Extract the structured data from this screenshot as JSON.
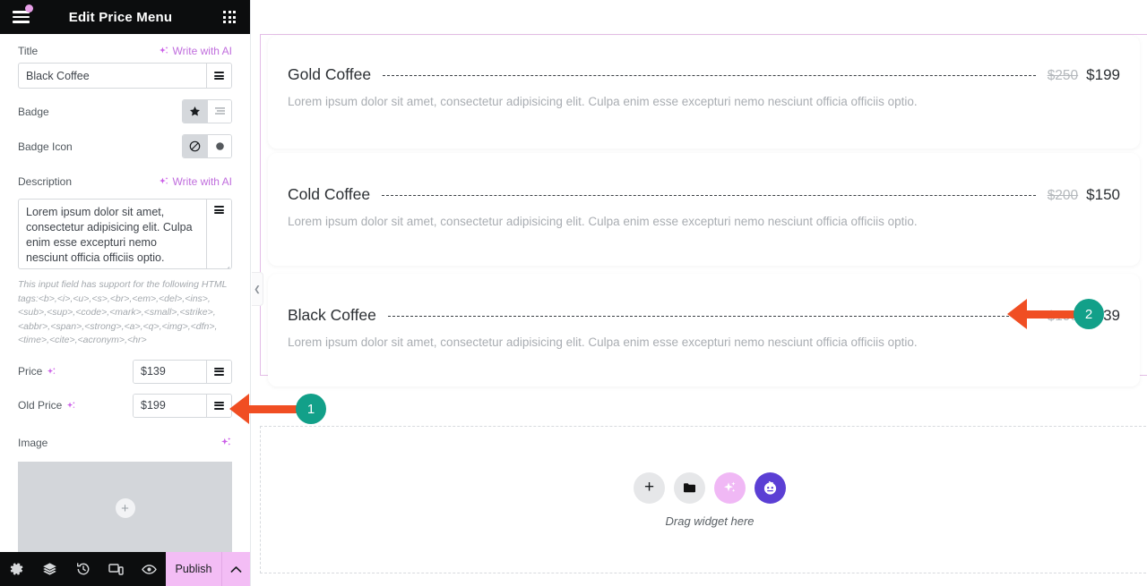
{
  "panel": {
    "title": "Edit Price Menu",
    "hamburger_icon": "hamburger-menu-icon",
    "grid_icon": "apps-grid-icon",
    "fields": {
      "title": {
        "label": "Title",
        "ai_label": "Write with AI",
        "value": "Black Coffee",
        "placeholder": ""
      },
      "badge": {
        "label": "Badge",
        "options": [
          "star",
          "list"
        ],
        "selected": "star"
      },
      "badge_icon": {
        "label": "Badge Icon",
        "options": [
          "none",
          "circle"
        ],
        "selected": "none"
      },
      "description": {
        "label": "Description",
        "ai_label": "Write with AI",
        "value": "Lorem ipsum dolor sit amet, consectetur adipisicing elit. Culpa enim esse excepturi nemo nesciunt officia officiis optio.",
        "help": "This input field has support for the following HTML tags:<b>,<i>,<u>,<s>,<br>,<em>,<del>,<ins>,<sub>,<sup>,<code>,<mark>,<small>,<strike>,<abbr>,<span>,<strong>,<a>,<q>,<img>,<dfn>,<time>,<cite>,<acronym>,<hr>"
      },
      "price": {
        "label": "Price",
        "value": "$139"
      },
      "old_price": {
        "label": "Old Price",
        "value": "$199"
      },
      "image": {
        "label": "Image",
        "add_icon": "plus-icon"
      }
    },
    "footer": {
      "icons": [
        "gear-icon",
        "layers-icon",
        "history-icon",
        "responsive-icon",
        "preview-eye-icon"
      ],
      "publish_label": "Publish",
      "caret_icon": "chevron-up-icon"
    }
  },
  "canvas": {
    "accent_border": "#e3bde6",
    "items": [
      {
        "title": "Gold Coffee",
        "old_price": "$250",
        "price": "$199",
        "description": "Lorem ipsum dolor sit amet, consectetur adipisicing elit. Culpa enim esse excepturi nemo nesciunt officia officiis optio."
      },
      {
        "title": "Cold Coffee",
        "old_price": "$200",
        "price": "$150",
        "description": "Lorem ipsum dolor sit amet, consectetur adipisicing elit. Culpa enim esse excepturi nemo nesciunt officia officiis optio."
      },
      {
        "title": "Black Coffee",
        "old_price": "$199",
        "price": "$139",
        "description": "Lorem ipsum dolor sit amet, consectetur adipisicing elit. Culpa enim esse excepturi nemo nesciunt officia officiis optio."
      }
    ],
    "drop_zone": {
      "label": "Drag widget here",
      "icons": [
        "plus-icon",
        "folder-icon",
        "ai-sparkle-icon",
        "ai-bot-icon"
      ]
    },
    "collapse_handle_icon": "chevron-left-icon"
  },
  "annotations": [
    {
      "number": "1",
      "color": "#12a089",
      "arrow_color": "#f04e23"
    },
    {
      "number": "2",
      "color": "#12a089",
      "arrow_color": "#f04e23"
    }
  ]
}
